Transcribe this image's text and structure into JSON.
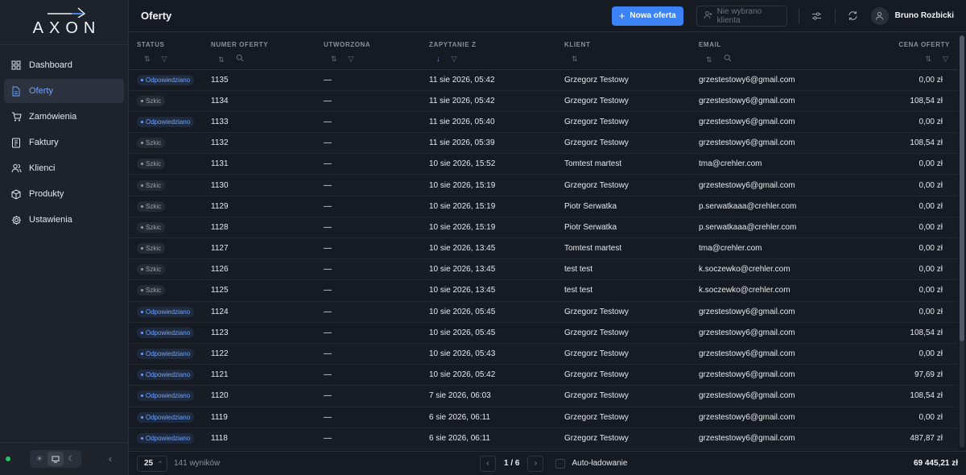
{
  "brand": {
    "name": "AXON"
  },
  "sidebar": {
    "items": [
      {
        "label": "Dashboard",
        "icon": "dashboard-icon",
        "active": false
      },
      {
        "label": "Oferty",
        "icon": "offers-icon",
        "active": true
      },
      {
        "label": "Zamówienia",
        "icon": "cart-icon",
        "active": false
      },
      {
        "label": "Faktury",
        "icon": "invoice-icon",
        "active": false
      },
      {
        "label": "Klienci",
        "icon": "users-icon",
        "active": false
      },
      {
        "label": "Produkty",
        "icon": "box-icon",
        "active": false
      },
      {
        "label": "Ustawienia",
        "icon": "gear-icon",
        "active": false
      }
    ]
  },
  "header": {
    "title": "Oferty",
    "new_offer_label": "Nowa oferta",
    "client_placeholder": "Nie wybrano klienta",
    "user_name": "Bruno Rozbicki"
  },
  "colors": {
    "accent": "#3b82f6",
    "status_responded": "#6fa3ff",
    "online": "#22c55e"
  },
  "table": {
    "columns": [
      "STATUS",
      "NUMER OFERTY",
      "UTWORZONA",
      "ZAPYTANIE Z",
      "KLIENT",
      "EMAIL",
      "CENA OFERTY"
    ],
    "rows": [
      {
        "status": "Odpowiedziano",
        "kind": "resp",
        "number": "1135",
        "created": "—",
        "request": "11 sie 2026, 05:42",
        "client": "Grzegorz Testowy",
        "email": "grzestestowy6@gmail.com",
        "price": "0,00 zł"
      },
      {
        "status": "Szkic",
        "kind": "draft",
        "number": "1134",
        "created": "—",
        "request": "11 sie 2026, 05:42",
        "client": "Grzegorz Testowy",
        "email": "grzestestowy6@gmail.com",
        "price": "108,54 zł"
      },
      {
        "status": "Odpowiedziano",
        "kind": "resp",
        "number": "1133",
        "created": "—",
        "request": "11 sie 2026, 05:40",
        "client": "Grzegorz Testowy",
        "email": "grzestestowy6@gmail.com",
        "price": "0,00 zł"
      },
      {
        "status": "Szkic",
        "kind": "draft",
        "number": "1132",
        "created": "—",
        "request": "11 sie 2026, 05:39",
        "client": "Grzegorz Testowy",
        "email": "grzestestowy6@gmail.com",
        "price": "108,54 zł"
      },
      {
        "status": "Szkic",
        "kind": "draft",
        "number": "1131",
        "created": "—",
        "request": "10 sie 2026, 15:52",
        "client": "Tomtest martest",
        "email": "tma@crehler.com",
        "price": "0,00 zł"
      },
      {
        "status": "Szkic",
        "kind": "draft",
        "number": "1130",
        "created": "—",
        "request": "10 sie 2026, 15:19",
        "client": "Grzegorz Testowy",
        "email": "grzestestowy6@gmail.com",
        "price": "0,00 zł"
      },
      {
        "status": "Szkic",
        "kind": "draft",
        "number": "1129",
        "created": "—",
        "request": "10 sie 2026, 15:19",
        "client": "Piotr Serwatka",
        "email": "p.serwatkaaa@crehler.com",
        "price": "0,00 zł"
      },
      {
        "status": "Szkic",
        "kind": "draft",
        "number": "1128",
        "created": "—",
        "request": "10 sie 2026, 15:19",
        "client": "Piotr Serwatka",
        "email": "p.serwatkaaa@crehler.com",
        "price": "0,00 zł"
      },
      {
        "status": "Szkic",
        "kind": "draft",
        "number": "1127",
        "created": "—",
        "request": "10 sie 2026, 13:45",
        "client": "Tomtest martest",
        "email": "tma@crehler.com",
        "price": "0,00 zł"
      },
      {
        "status": "Szkic",
        "kind": "draft",
        "number": "1126",
        "created": "—",
        "request": "10 sie 2026, 13:45",
        "client": "test test",
        "email": "k.soczewko@crehler.com",
        "price": "0,00 zł"
      },
      {
        "status": "Szkic",
        "kind": "draft",
        "number": "1125",
        "created": "—",
        "request": "10 sie 2026, 13:45",
        "client": "test test",
        "email": "k.soczewko@crehler.com",
        "price": "0,00 zł"
      },
      {
        "status": "Odpowiedziano",
        "kind": "resp",
        "number": "1124",
        "created": "—",
        "request": "10 sie 2026, 05:45",
        "client": "Grzegorz Testowy",
        "email": "grzestestowy6@gmail.com",
        "price": "0,00 zł"
      },
      {
        "status": "Odpowiedziano",
        "kind": "resp",
        "number": "1123",
        "created": "—",
        "request": "10 sie 2026, 05:45",
        "client": "Grzegorz Testowy",
        "email": "grzestestowy6@gmail.com",
        "price": "108,54 zł"
      },
      {
        "status": "Odpowiedziano",
        "kind": "resp",
        "number": "1122",
        "created": "—",
        "request": "10 sie 2026, 05:43",
        "client": "Grzegorz Testowy",
        "email": "grzestestowy6@gmail.com",
        "price": "0,00 zł"
      },
      {
        "status": "Odpowiedziano",
        "kind": "resp",
        "number": "1121",
        "created": "—",
        "request": "10 sie 2026, 05:42",
        "client": "Grzegorz Testowy",
        "email": "grzestestowy6@gmail.com",
        "price": "97,69 zł"
      },
      {
        "status": "Odpowiedziano",
        "kind": "resp",
        "number": "1120",
        "created": "—",
        "request": "7 sie 2026, 06:03",
        "client": "Grzegorz Testowy",
        "email": "grzestestowy6@gmail.com",
        "price": "108,54 zł"
      },
      {
        "status": "Odpowiedziano",
        "kind": "resp",
        "number": "1119",
        "created": "—",
        "request": "6 sie 2026, 06:11",
        "client": "Grzegorz Testowy",
        "email": "grzestestowy6@gmail.com",
        "price": "0,00 zł"
      },
      {
        "status": "Odpowiedziano",
        "kind": "resp",
        "number": "1118",
        "created": "—",
        "request": "6 sie 2026, 06:11",
        "client": "Grzegorz Testowy",
        "email": "grzestestowy6@gmail.com",
        "price": "487,87 zł"
      }
    ]
  },
  "footer": {
    "page_size": "25",
    "results": "141 wyników",
    "page_info": "1 / 6",
    "auto_load_label": "Auto-ładowanie",
    "total": "69 445,21 zł"
  }
}
